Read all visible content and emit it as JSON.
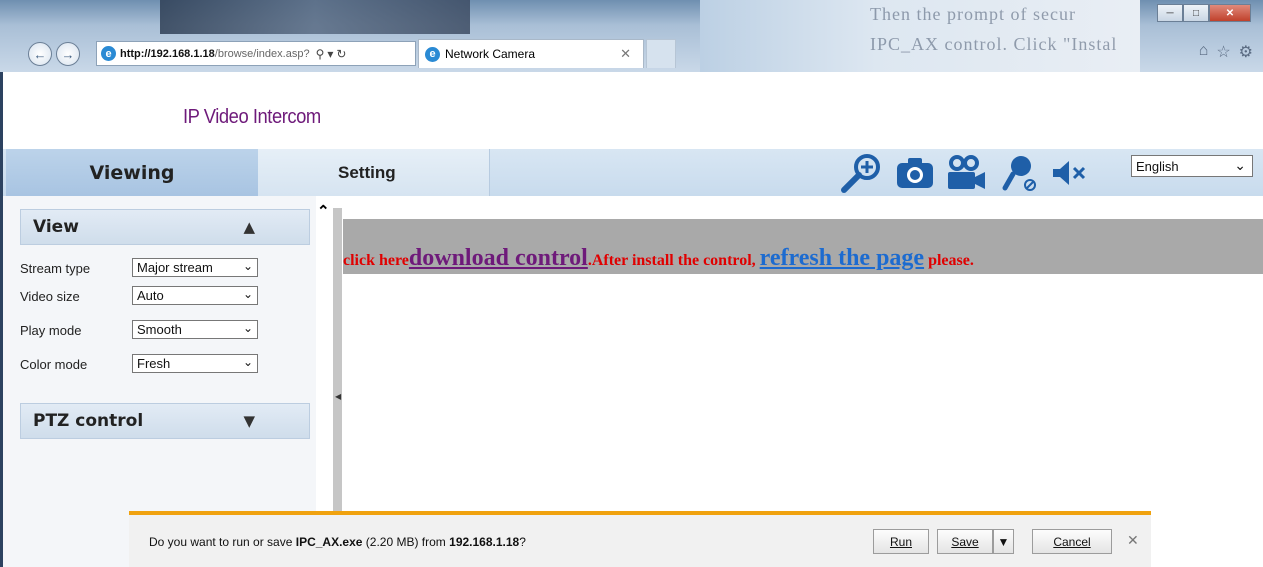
{
  "browser": {
    "url_host": "http://192.168.1.18",
    "url_path": "/browse/index.asp?",
    "tab_title": "Network Camera",
    "bg_text_line1": "Then the prompt of secur",
    "bg_text_line2": "IPC_AX control. Click \"Instal"
  },
  "header": {
    "title": "IP Video Intercom"
  },
  "nav": {
    "tabs": [
      {
        "label": "Viewing"
      },
      {
        "label": "Setting"
      }
    ],
    "language": "English",
    "tools": [
      "zoom-in-icon",
      "camera-snapshot-icon",
      "video-record-icon",
      "microphone-off-icon",
      "speaker-mute-icon"
    ]
  },
  "sidebar": {
    "view_title": "View",
    "rows": [
      {
        "label": "Stream type",
        "value": "Major stream"
      },
      {
        "label": "Video size",
        "value": "Auto"
      },
      {
        "label": "Play mode",
        "value": "Smooth"
      },
      {
        "label": "Color mode",
        "value": "Fresh"
      }
    ],
    "ptz_title": "PTZ control"
  },
  "content": {
    "msg_prefix": "click here",
    "download_link": "download control",
    "msg_middle": ".After install the control, ",
    "refresh_link": "refresh the page",
    "msg_suffix": " please."
  },
  "download_bar": {
    "question_prefix": "Do you want to run or save ",
    "filename": "IPC_AX.exe",
    "size": " (2.20 MB) from ",
    "source": "192.168.1.18",
    "question_suffix": "?",
    "run_label": "Run",
    "save_label": "Save",
    "cancel_label": "Cancel"
  },
  "colors": {
    "accent": "#6e1a7a",
    "link": "#1c6bd0",
    "warning_text": "#e00000",
    "download_bar_border": "#f0a20f"
  }
}
